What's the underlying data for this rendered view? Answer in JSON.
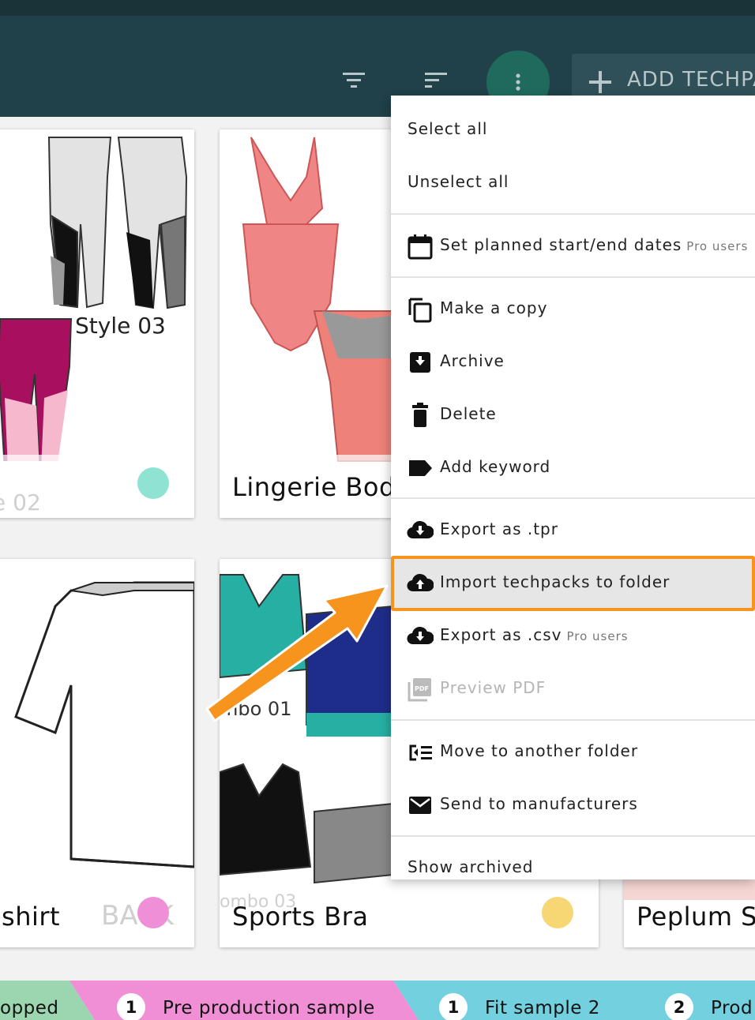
{
  "header": {
    "add_button_label": "ADD TECHPA",
    "icons": [
      "filter-icon",
      "sort-icon",
      "more-vert-icon",
      "plus-icon"
    ]
  },
  "cards": [
    {
      "title": "e 02",
      "sketch_label": "Style 03",
      "dot_color": "#8ee3d3"
    },
    {
      "title": "Lingerie Body",
      "sub": "",
      "dot_color": ""
    },
    {
      "title": "-shirt",
      "ghost": "BACK",
      "dot_color": "#ef8fd7"
    },
    {
      "title": "Sports Bra",
      "ghost_top": "mbo 01",
      "ghost_bottom": "ombo 03",
      "dot_color": "#f7d774"
    },
    {
      "title": "Peplum S"
    }
  ],
  "menu": {
    "select_all": "Select all",
    "unselect_all": "Unselect all",
    "set_dates": "Set planned start/end dates",
    "set_dates_pro": "Pro users",
    "make_copy": "Make a copy",
    "archive": "Archive",
    "delete": "Delete",
    "add_keyword": "Add keyword",
    "export_tpr": "Export as .tpr",
    "import_techpacks": "Import techpacks to folder",
    "export_csv": "Export as .csv",
    "export_csv_pro": "Pro users",
    "preview_pdf": "Preview PDF",
    "move_folder": "Move to another folder",
    "send_manufacturers": "Send to manufacturers",
    "show_archived": "Show archived"
  },
  "status_bar": [
    {
      "label": "opped",
      "count": "",
      "color": "#9bd6b0"
    },
    {
      "label": "Pre production sample",
      "count": "1",
      "color": "#f08fd6"
    },
    {
      "label": "Fit sample 2",
      "count": "1",
      "color": "#72d0df"
    },
    {
      "label": "Prod",
      "count": "2",
      "color": "#72d0df"
    }
  ],
  "colors": {
    "header_bg": "#20414a",
    "accent": "#1f6a5c",
    "highlight": "#f7941d"
  }
}
